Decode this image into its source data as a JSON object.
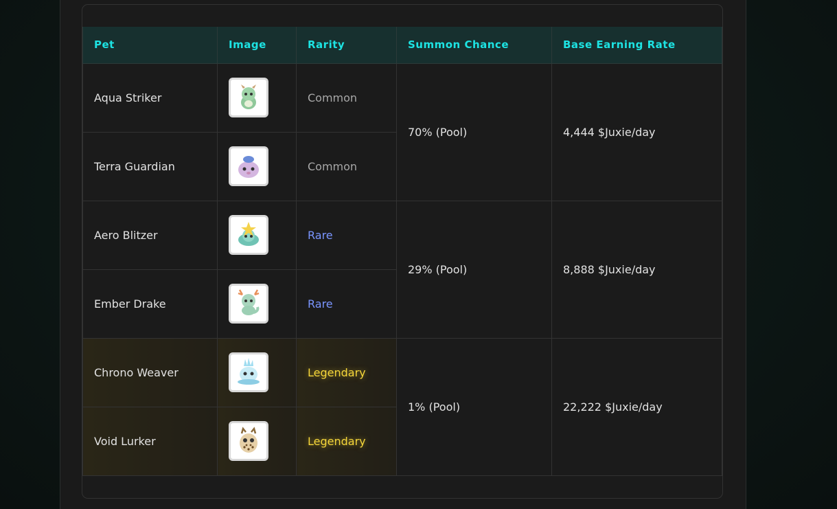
{
  "table": {
    "headers": [
      "Pet",
      "Image",
      "Rarity",
      "Summon Chance",
      "Base Earning Rate"
    ],
    "pets": [
      {
        "name": "Aqua Striker",
        "icon": "green-dragon-pet-icon",
        "rarity": "Common"
      },
      {
        "name": "Terra Guardian",
        "icon": "purple-blob-pet-icon",
        "rarity": "Common"
      },
      {
        "name": "Aero Blitzer",
        "icon": "star-blob-pet-icon",
        "rarity": "Rare"
      },
      {
        "name": "Ember Drake",
        "icon": "horned-dragon-pet-icon",
        "rarity": "Rare"
      },
      {
        "name": "Chrono Weaver",
        "icon": "ice-crystal-pet-icon",
        "rarity": "Legendary"
      },
      {
        "name": "Void Lurker",
        "icon": "spotted-owl-pet-icon",
        "rarity": "Legendary"
      }
    ],
    "groups": [
      {
        "chance": "70% (Pool)",
        "rate": "4,444 $Juxie/day"
      },
      {
        "chance": "29% (Pool)",
        "rate": "8,888 $Juxie/day"
      },
      {
        "chance": "1% (Pool)",
        "rate": "22,222 $Juxie/day"
      }
    ]
  },
  "colors": {
    "header_text": "#1de3e3",
    "common": "#a8a8a8",
    "rare": "#7a95ff",
    "legendary": "#f5d63a"
  }
}
